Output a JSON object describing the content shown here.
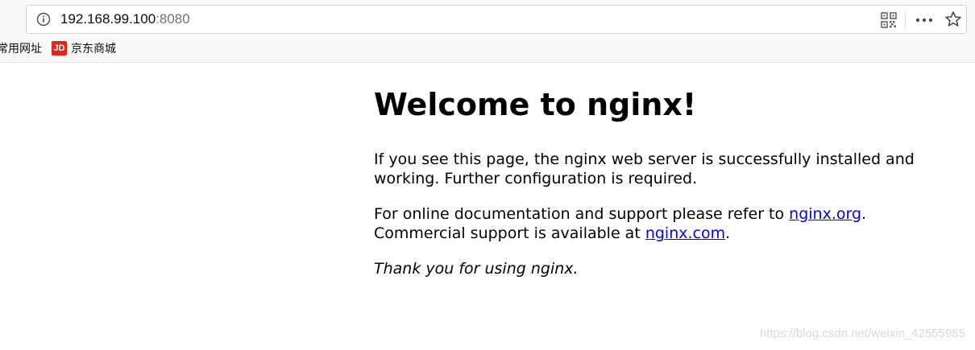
{
  "browser": {
    "url_host": "192.168.99.100",
    "url_port": ":8080",
    "bookmarks": [
      {
        "label": "常用网址"
      },
      {
        "label": "京东商城",
        "logo_text": "JD"
      }
    ]
  },
  "page": {
    "heading": "Welcome to nginx!",
    "p1": "If you see this page, the nginx web server is successfully installed and working. Further configuration is required.",
    "p2_text": "For online documentation and support please refer to ",
    "p2_link": "nginx.org",
    "p2_end": ".",
    "p3_text": "Commercial support is available at ",
    "p3_link": "nginx.com",
    "p3_end": ".",
    "thanks": "Thank you for using nginx."
  },
  "watermark": "https://blog.csdn.net/weixin_42555985",
  "colors": {
    "link": "#0000ee",
    "jd_brand": "#e1251b"
  }
}
